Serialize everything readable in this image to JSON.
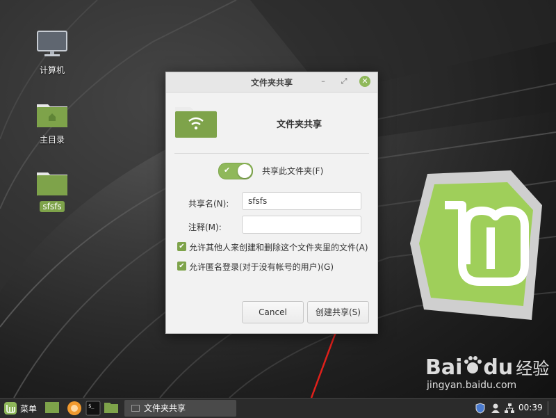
{
  "desktop": {
    "icons": [
      {
        "label": "计算机",
        "icon": "computer-icon"
      },
      {
        "label": "主目录",
        "icon": "home-folder-icon"
      },
      {
        "label": "sfsfs",
        "icon": "folder-icon",
        "selected": true
      }
    ]
  },
  "dialog": {
    "title": "文件夹共享",
    "header_title": "文件夹共享",
    "share_toggle_label": "共享此文件夹(F)",
    "share_toggle_on": true,
    "share_name_label": "共享名(N):",
    "share_name_value": "sfsfs",
    "comment_label": "注释(M):",
    "comment_value": "",
    "allow_others_label": "允许其他人来创建和删除这个文件夹里的文件(A)",
    "allow_others_checked": true,
    "guest_access_label": "允许匿名登录(对于没有帐号的用户)(G)",
    "guest_access_checked": true,
    "cancel_label": "Cancel",
    "create_share_label": "创建共享(S)"
  },
  "taskbar": {
    "menu_label": "菜单",
    "window_label": "文件夹共享",
    "clock": "00:39"
  },
  "watermark": {
    "brand": "Bai",
    "brand2": "du",
    "brand_cn": "经验",
    "url": "jingyan.baidu.com"
  },
  "colors": {
    "accent": "#8fb85a",
    "folder": "#7ea34a",
    "arrow": "#e0201b"
  }
}
